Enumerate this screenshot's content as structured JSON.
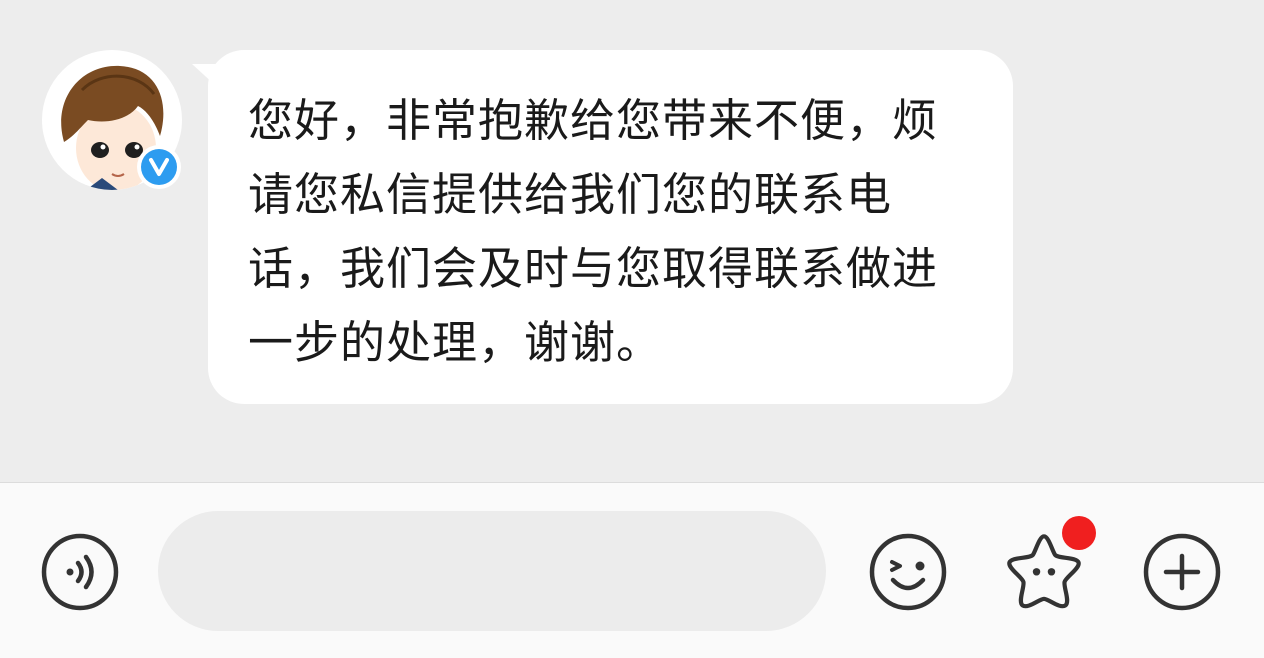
{
  "chat": {
    "message": {
      "text": "您好，非常抱歉给您带来不便，烦请您私信提供给我们您的联系电话，我们会及时与您取得联系做进一步的处理，谢谢。"
    },
    "sender": {
      "avatar_icon": "cartoon-avatar",
      "badge_icon": "verified-v-icon",
      "badge_color": "#2d9cf0"
    }
  },
  "input_bar": {
    "voice_icon": "voice-icon",
    "input_value": "",
    "emoji_icon": "emoji-icon",
    "sticker_icon": "sticker-icon",
    "notification_color": "#f01f1f",
    "plus_icon": "plus-icon"
  }
}
